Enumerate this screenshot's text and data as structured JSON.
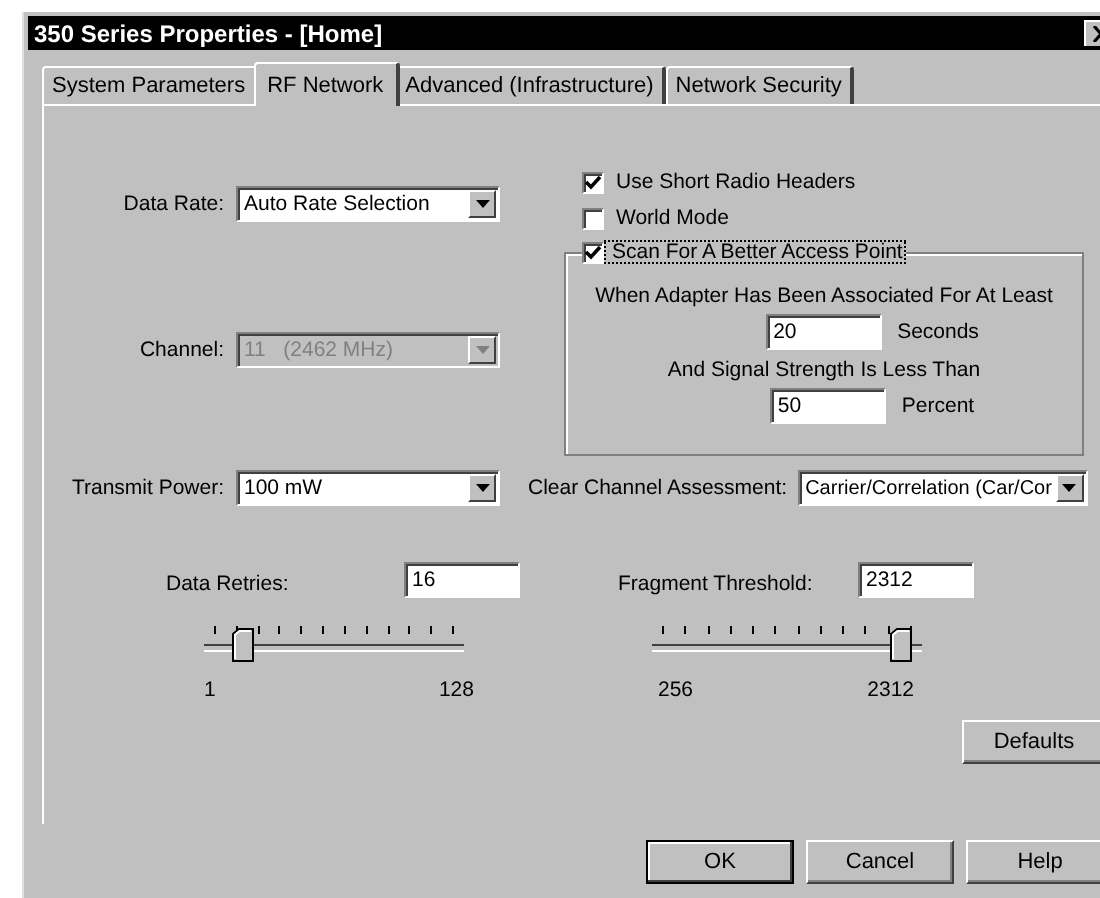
{
  "window": {
    "title": "350 Series Properties - [Home]"
  },
  "tabs": [
    {
      "label": "System Parameters",
      "selected": false
    },
    {
      "label": "RF Network",
      "selected": true
    },
    {
      "label": "Advanced (Infrastructure)",
      "selected": false
    },
    {
      "label": "Network Security",
      "selected": false
    }
  ],
  "data_rate": {
    "label": "Data Rate:",
    "value": "Auto Rate Selection",
    "disabled": false
  },
  "channel": {
    "label": "Channel:",
    "value": "11   (2462 MHz)",
    "disabled": true
  },
  "checkboxes": [
    {
      "label": "Use Short Radio Headers",
      "checked": true
    },
    {
      "label": "World Mode",
      "checked": false
    }
  ],
  "scan_group": {
    "label": "Scan For A Better Access Point",
    "checked": true,
    "focused": true,
    "associated_label": "When Adapter Has Been Associated For At Least",
    "seconds": "20",
    "seconds_unit": "Seconds",
    "signal_label": "And Signal Strength Is Less Than",
    "percent": "50",
    "percent_unit": "Percent"
  },
  "transmit_power": {
    "label": "Transmit Power:",
    "value": "100 mW",
    "disabled": false
  },
  "clear_channel_assessment": {
    "label": "Clear Channel Assessment:",
    "value": "Carrier/Correlation (Car/Cor",
    "disabled": false
  },
  "sliders": [
    {
      "label": "Data Retries:",
      "value": "16",
      "level": 0.12,
      "min": "1",
      "max": "128"
    },
    {
      "label": "Fragment Threshold:",
      "value": "2312",
      "level": 1,
      "min": "256",
      "max": "2312"
    }
  ],
  "defaults_button": "Defaults",
  "buttons": [
    {
      "label": "OK",
      "default": true
    },
    {
      "label": "Cancel",
      "default": false
    },
    {
      "label": "Help",
      "default": false
    }
  ]
}
